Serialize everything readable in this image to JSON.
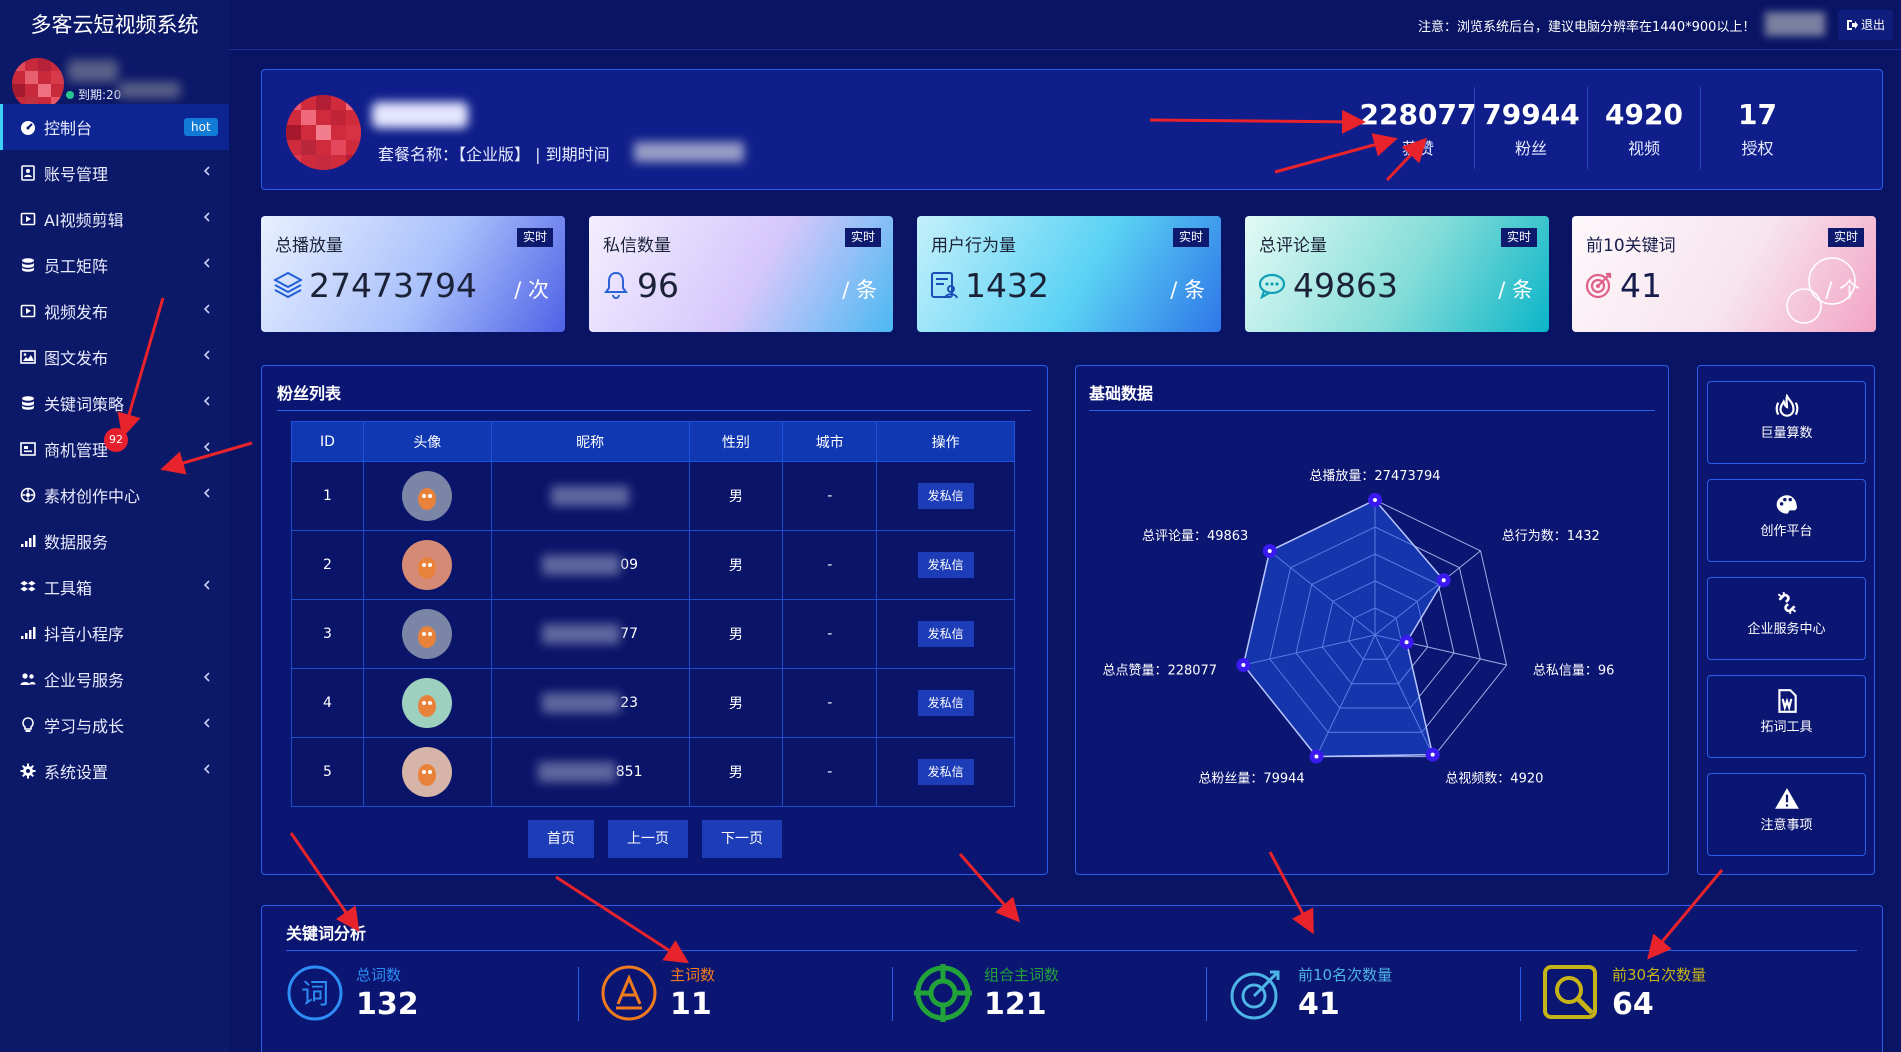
{
  "app": {
    "title": "多客云短视频系统"
  },
  "user": {
    "expiry_prefix": "到期:20"
  },
  "sidebar": {
    "items": [
      {
        "label": "控制台",
        "icon": "dashboard-icon",
        "badge": "hot"
      },
      {
        "label": "账号管理",
        "icon": "account-icon"
      },
      {
        "label": "AI视频剪辑",
        "icon": "video-edit-icon"
      },
      {
        "label": "员工矩阵",
        "icon": "database-icon"
      },
      {
        "label": "视频发布",
        "icon": "video-publish-icon"
      },
      {
        "label": "图文发布",
        "icon": "image-icon"
      },
      {
        "label": "关键词策略",
        "icon": "database-icon"
      },
      {
        "label": "商机管理",
        "icon": "business-icon",
        "count": "92"
      },
      {
        "label": "素材创作中心",
        "icon": "material-icon"
      },
      {
        "label": "数据服务",
        "icon": "signal-icon"
      },
      {
        "label": "工具箱",
        "icon": "dropbox-icon"
      },
      {
        "label": "抖音小程序",
        "icon": "signal-icon"
      },
      {
        "label": "企业号服务",
        "icon": "users-icon"
      },
      {
        "label": "学习与成长",
        "icon": "bulb-icon"
      },
      {
        "label": "系统设置",
        "icon": "gear-icon"
      }
    ]
  },
  "topbar": {
    "notice": "注意：浏览系统后台，建议电脑分辨率在1440*900以上！",
    "logout_label": "退出"
  },
  "header": {
    "package_text": "套餐名称：【企业版】 | 到期时间",
    "stats": [
      {
        "value": "228077",
        "label": "获赞"
      },
      {
        "value": "79944",
        "label": "粉丝"
      },
      {
        "value": "4920",
        "label": "视频"
      },
      {
        "value": "17",
        "label": "授权"
      }
    ]
  },
  "stat_cards": [
    {
      "title": "总播放量",
      "tag": "实时",
      "value": "27473794",
      "unit": "/ 次",
      "icon": "layers-icon",
      "gradient": [
        "#e8f0ff",
        "#a9c0fb",
        "#4f61e6"
      ]
    },
    {
      "title": "私信数量",
      "tag": "实时",
      "value": "96",
      "unit": "/ 条",
      "icon": "bell-icon",
      "gradient": [
        "#f3eeff",
        "#d5c7fb",
        "#4bb8f2"
      ]
    },
    {
      "title": "用户行为量",
      "tag": "实时",
      "value": "1432",
      "unit": "/ 条",
      "icon": "user-doc-icon",
      "gradient": [
        "#c4f0fb",
        "#5ad2f4",
        "#2f76e8"
      ]
    },
    {
      "title": "总评论量",
      "tag": "实时",
      "value": "49863",
      "unit": "/ 条",
      "icon": "comment-icon",
      "gradient": [
        "#e3faf5",
        "#82dcd8",
        "#0bb5c8"
      ]
    },
    {
      "title": "前10关键词",
      "tag": "实时",
      "value": "41",
      "unit": "/ 个",
      "icon": "target-icon",
      "gradient": [
        "#fdf8fb",
        "#f7e4ee",
        "#f2a3c4"
      ]
    }
  ],
  "fans": {
    "title": "粉丝列表",
    "columns": [
      "ID",
      "头像",
      "昵称",
      "性别",
      "城市",
      "操作"
    ],
    "rows": [
      {
        "id": "1",
        "nick_suffix": "",
        "gender": "男",
        "city": "-",
        "action": "发私信",
        "avatar_color": "#7b86a6"
      },
      {
        "id": "2",
        "nick_suffix": "09",
        "gender": "男",
        "city": "-",
        "action": "发私信",
        "avatar_color": "#d58a75"
      },
      {
        "id": "3",
        "nick_suffix": "77",
        "gender": "男",
        "city": "-",
        "action": "发私信",
        "avatar_color": "#7b86a6"
      },
      {
        "id": "4",
        "nick_suffix": "23",
        "gender": "男",
        "city": "-",
        "action": "发私信",
        "avatar_color": "#9ed0c0"
      },
      {
        "id": "5",
        "nick_suffix": "851",
        "gender": "男",
        "city": "-",
        "action": "发私信",
        "avatar_color": "#d6b4a8"
      }
    ],
    "pagination": [
      "首页",
      "上一页",
      "下一页"
    ]
  },
  "basic": {
    "title": "基础数据",
    "radar": [
      {
        "label": "总播放量：27473794",
        "value": 27473794,
        "max": 27473794
      },
      {
        "label": "总行为数：1432",
        "value": 1432,
        "max": 2200
      },
      {
        "label": "总私信量：96",
        "value": 96,
        "max": 400
      },
      {
        "label": "总视频数：4920",
        "value": 4920,
        "max": 5000
      },
      {
        "label": "总粉丝量：79944",
        "value": 79944,
        "max": 80000
      },
      {
        "label": "总点赞量：228077",
        "value": 228077,
        "max": 228077
      },
      {
        "label": "总评论量：49863",
        "value": 49863,
        "max": 50000
      }
    ]
  },
  "tools": [
    {
      "label": "巨量算数",
      "icon": "fire-icon"
    },
    {
      "label": "创作平台",
      "icon": "palette-icon"
    },
    {
      "label": "企业服务中心",
      "icon": "unlink-icon"
    },
    {
      "label": "拓词工具",
      "icon": "word-file-icon"
    },
    {
      "label": "注意事项",
      "icon": "warning-icon"
    }
  ],
  "keywords": {
    "title": "关键词分析",
    "stats": [
      {
        "label": "总词数",
        "value": "132",
        "color": "#2e8df5",
        "icon": "word-icon"
      },
      {
        "label": "主词数",
        "value": "11",
        "color": "#f07a1e",
        "icon": "a-circle-icon"
      },
      {
        "label": "组合主词数",
        "value": "121",
        "color": "#22a33a",
        "icon": "crosshair-icon"
      },
      {
        "label": "前10名次数量",
        "value": "41",
        "color": "#4db5e6",
        "icon": "target-arrow-icon"
      },
      {
        "label": "前30名次数量",
        "value": "64",
        "color": "#c6b416",
        "icon": "magnifier-icon"
      }
    ]
  },
  "colors": {
    "accent": "#2b5ee8",
    "background": "#0a1465",
    "sidebar": "#0c1868",
    "arrow": "#e8232b"
  }
}
